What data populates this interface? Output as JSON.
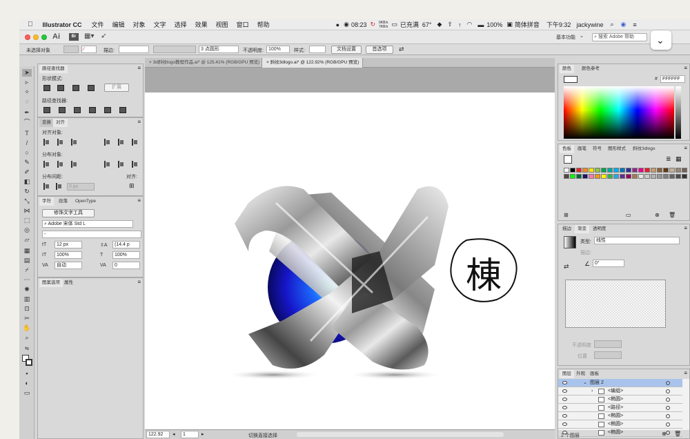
{
  "menubar": {
    "app_name": "Illustrator CC",
    "menus": [
      "文件",
      "编辑",
      "对象",
      "文字",
      "选择",
      "效果",
      "视图",
      "窗口",
      "帮助"
    ],
    "clock": "08:23",
    "net_up": "0KB/s",
    "net_down": "7KB/s",
    "charge": "已充满",
    "temp": "67°",
    "battery": "100%",
    "input_method": "简体拼音",
    "time": "下午9:32",
    "user": "jackywine"
  },
  "app": {
    "logo": "Ai",
    "bridge": "Br",
    "workspace": "基本功能",
    "search_placeholder": "搜索 Adobe 帮助"
  },
  "controlbar": {
    "selection": "未选择对象",
    "stroke_label": "描边:",
    "brush": "3 点圆形",
    "opacity_label": "不透明度:",
    "opacity": "100%",
    "style_label": "样式:",
    "doc_settings": "文档设置",
    "preferences": "首选项"
  },
  "pathfinder": {
    "tab": "路径查找器",
    "shape_modes": "形状模式:",
    "expand": "扩展",
    "pathfinders": "路径查找器:"
  },
  "align": {
    "tabs": [
      "变换",
      "对齐"
    ],
    "align_objects": "对齐对象:",
    "distribute_objects": "分布对象:",
    "distribute_spacing": "分布间距:",
    "spacing_value": "0 px",
    "align_to": "对齐:"
  },
  "character": {
    "tabs": [
      "字符",
      "段落",
      "OpenType"
    ],
    "touch_type": "修饰文字工具",
    "font": "Adobe 宋体 Std L",
    "style": "-",
    "size": "12 px",
    "leading": "(14.4 p",
    "vscale": "100%",
    "hscale": "100%",
    "kerning": "自动",
    "tracking": "0"
  },
  "bottomleft_tabs": [
    "图案选项",
    "属性"
  ],
  "doctabs": [
    {
      "label": "3d斜纹logo教程作品.ai* @ 125.41% (RGB/GPU 预览)"
    },
    {
      "label": "斜纹3dlogo.ai* @ 122.92% (RGB/GPU 预览)"
    }
  ],
  "status": {
    "zoom": "122.92",
    "page": "1",
    "tool": "切换直接选择"
  },
  "color_panel": {
    "tabs": [
      "颜色",
      "颜色参考"
    ],
    "hex": "FFFFFF"
  },
  "swatch_tabs": [
    "色板",
    "画笔",
    "符号",
    "图形样式",
    "斜纹3dlogo"
  ],
  "swatch_colors": [
    "#ffffff",
    "#000000",
    "#e6262a",
    "#f28a1e",
    "#ffe600",
    "#8dc63f",
    "#00a651",
    "#00a99d",
    "#00aeef",
    "#0072bc",
    "#2e3192",
    "#92278f",
    "#ec008c",
    "#ed1c24",
    "#c69c6d",
    "#8c6239",
    "#603913",
    "#c2b59b",
    "#998675",
    "#736357",
    "#534741",
    "#00ff00",
    "#006837",
    "#1b1464",
    "#ff7bac",
    "#f7941d",
    "#fff200",
    "#39b54a",
    "#29abe2",
    "#662d91",
    "#9e005d",
    "#a67c52",
    "#e6e6e6",
    "#cccccc",
    "#b3b3b3",
    "#999999",
    "#808080",
    "#666666",
    "#4d4d4d",
    "#333333"
  ],
  "stroke_panel": {
    "tabs": [
      "描边",
      "渐变",
      "透明度"
    ],
    "type_label": "类型:",
    "type": "线性",
    "stroke_label": "描边:",
    "angle": "0°",
    "opacity_label": "不透明度",
    "position_label": "位置"
  },
  "layers": {
    "tabs": [
      "图层",
      "外观",
      "画板"
    ],
    "rows": [
      {
        "name": "图层 2",
        "indent": 0
      },
      {
        "name": "<编组>",
        "indent": 1
      },
      {
        "name": "<椭圆>",
        "indent": 2
      },
      {
        "name": "<路径>",
        "indent": 2
      },
      {
        "name": "<椭圆>",
        "indent": 2
      },
      {
        "name": "<椭圆>",
        "indent": 2
      },
      {
        "name": "<椭圆>",
        "indent": 2
      }
    ],
    "count": "2 个图层"
  },
  "artwork": {
    "glyph": "棟"
  }
}
